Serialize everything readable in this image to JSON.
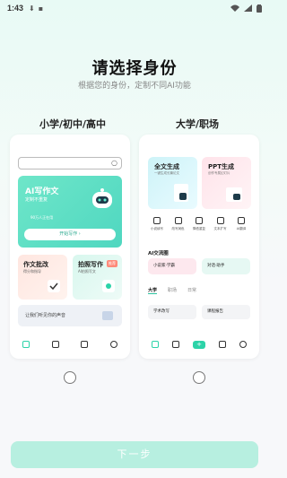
{
  "status": {
    "time": "1:43"
  },
  "header": {
    "title": "请选择身份",
    "subtitle": "根据您的身份，定制不同AI功能"
  },
  "left": {
    "label": "小学/初中/高中",
    "ai_write": {
      "title": "AI写作文",
      "subtitle": "定制不重复",
      "users": "90万人正在用",
      "cta": "开始写作 ›"
    },
    "mini1": {
      "title": "作文批改",
      "subtitle": "得分和指导"
    },
    "mini2": {
      "title": "拍照写作",
      "subtitle": "AI拍照写文",
      "badge": "推荐"
    },
    "voice": "让我们听见你的声音"
  },
  "right": {
    "label": "大学/职场",
    "top1": {
      "title": "全文生成",
      "subtitle": "一键生成长篇论文"
    },
    "top2": {
      "title": "PPT生成",
      "subtitle": "创作专属幻灯片"
    },
    "tools": [
      "小说续写",
      "改写润色",
      "降低重复",
      "文本扩写",
      "AI翻译"
    ],
    "aic_title": "AI交流圈",
    "pill1": "小说家·学霸",
    "pill2": "对话·助手",
    "tabs": [
      "大学",
      "职场",
      "日常"
    ],
    "rows": [
      "学术改写",
      "课程报告"
    ]
  },
  "next_button": "下一步",
  "colors": {
    "accent": "#2cd3a8",
    "next_bg": "#b7efe0"
  }
}
